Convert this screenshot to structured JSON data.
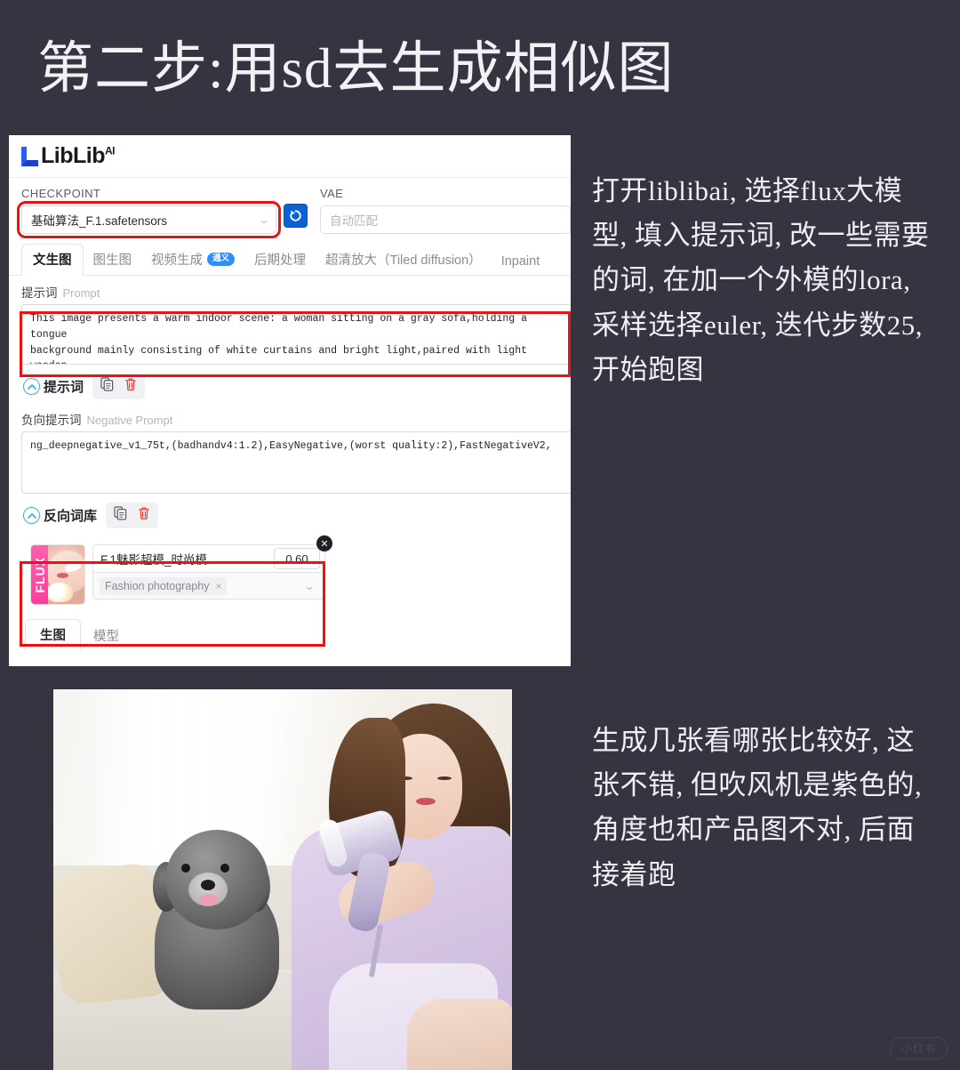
{
  "title": "第二步:用sd去生成相似图",
  "app": {
    "brand": {
      "name": "LibLib",
      "superscript": "AI",
      "logo_icon": "liblib-logo-icon"
    },
    "checkpoint": {
      "label": "CHECKPOINT",
      "value": "基础算法_F.1.safetensors",
      "chevron": "chevron-down-icon"
    },
    "refresh": {
      "icon": "refresh-icon"
    },
    "vae": {
      "label": "VAE",
      "placeholder": "自动匹配"
    },
    "tabs": [
      {
        "label": "文生图",
        "active": true
      },
      {
        "label": "图生图",
        "active": false
      },
      {
        "label": "视频生成",
        "badge": "通义",
        "active": false
      },
      {
        "label": "后期处理",
        "active": false
      },
      {
        "label": "超清放大（Tiled diffusion）",
        "active": false
      },
      {
        "label": "Inpaint",
        "active": false
      }
    ],
    "prompt": {
      "label_cn": "提示词",
      "label_en": "Prompt",
      "value": "This image presents a warm indoor scene: a woman sitting on a gray sofa,holding a tongue\nbackground mainly consisting of white curtains and bright light,paired with light wooden"
    },
    "prompt_toolbar": {
      "title": "提示词",
      "collapse_icon": "chevron-up-circle-icon",
      "copy_icon": "copy-icon",
      "delete_icon": "trash-icon"
    },
    "negative_prompt": {
      "label_cn": "负向提示词",
      "label_en": "Negative Prompt",
      "value": "ng_deepnegative_v1_75t,(badhandv4:1.2),EasyNegative,(worst quality:2),FastNegativeV2,"
    },
    "negative_toolbar": {
      "title": "反向词库",
      "collapse_icon": "chevron-up-circle-icon",
      "copy_icon": "copy-icon",
      "delete_icon": "trash-icon"
    },
    "lora": {
      "thumb_badge": "FLUX",
      "name": "F.1魅影超模_时尚模…",
      "weight": "0.60",
      "trigger_word": "Fashion photography",
      "chip_remove": "×",
      "close": "✕",
      "chevron": "chevron-down-icon"
    },
    "bottom_tabs": [
      {
        "label": "生图",
        "active": true
      },
      {
        "label": "模型",
        "active": false
      }
    ]
  },
  "notes": {
    "note1": "打开liblibai, 选择flux大模型, 填入提示词, 改一些需要的词, 在加一个外模的lora, 采样选择euler, 迭代步数25,开始跑图",
    "note2": "生成几张看哪张比较好, 这张不错, 但吹风机是紫色的, 角度也和产品图不对, 后面接着跑"
  },
  "photo": {
    "alt": "woman-with-hair-dryer-and-poodle-photo"
  },
  "watermark": "小红书",
  "colors": {
    "background": "#353440",
    "annotation_red": "#f01010",
    "accent_blue": "#0a62d6",
    "badge_blue": "#2f8ef7",
    "text_light": "#eef0f3"
  }
}
